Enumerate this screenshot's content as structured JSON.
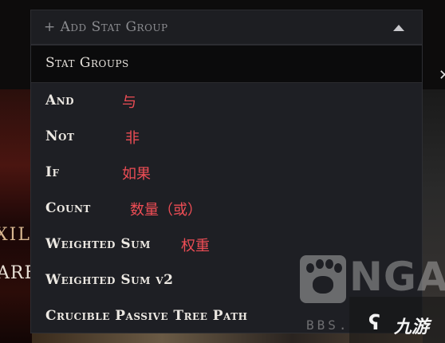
{
  "dropdown": {
    "placeholder": "+ Add Stat Group",
    "heading": "Stat Groups",
    "items": [
      {
        "label": "And",
        "note": "与"
      },
      {
        "label": "Not",
        "note": "非"
      },
      {
        "label": "If",
        "note": "如果"
      },
      {
        "label": "Count",
        "note": "数量（或）"
      },
      {
        "label": "Weighted Sum",
        "note": "权重"
      },
      {
        "label": "Weighted Sum v2",
        "note": ""
      },
      {
        "label": "Crucible Passive Tree Path",
        "note": ""
      }
    ]
  },
  "background": {
    "left_text_1": "XIL",
    "left_text_2": "ARE"
  },
  "watermark": {
    "brand": "NGA",
    "bbs": "BBS.",
    "jiuyou_logo": "九游"
  }
}
